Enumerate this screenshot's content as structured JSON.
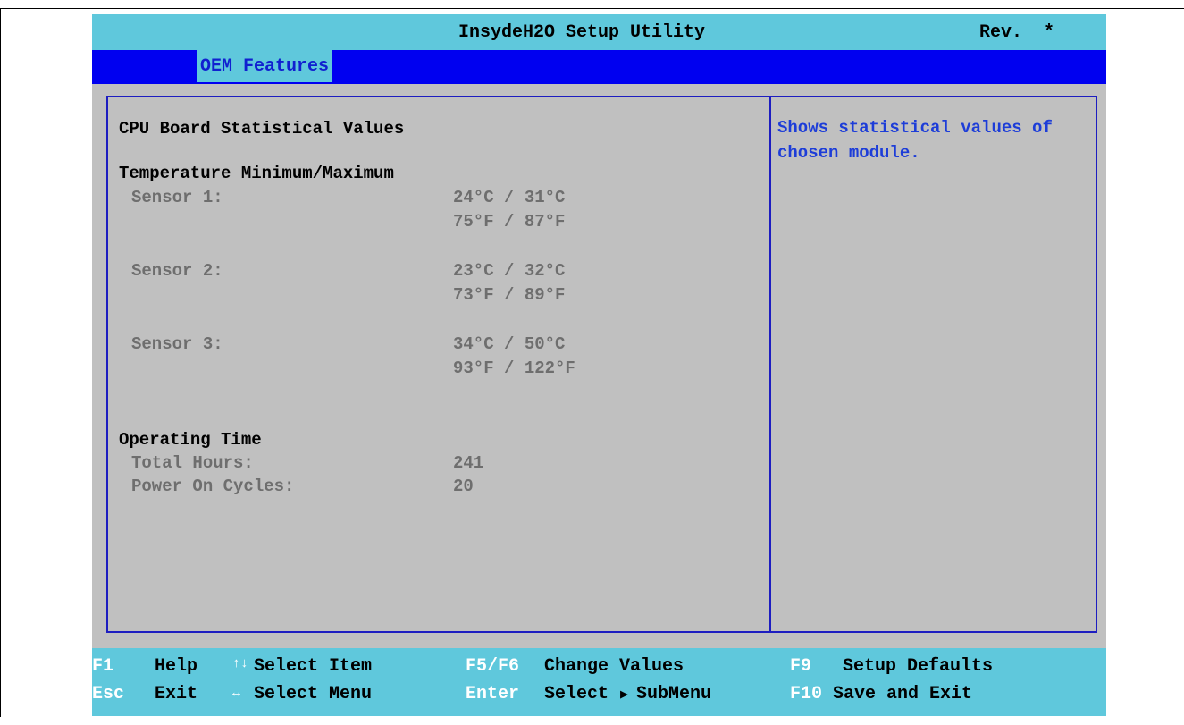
{
  "title": "InsydeH2O Setup Utility",
  "rev": "Rev.  *",
  "menu": {
    "active_tab": "OEM Features"
  },
  "main": {
    "heading": "CPU Board Statistical Values",
    "temp_heading": "Temperature Minimum/Maximum",
    "sensors": [
      {
        "label": "Sensor 1:",
        "celsius": "24°C / 31°C",
        "fahrenheit": "75°F / 87°F"
      },
      {
        "label": "Sensor 2:",
        "celsius": "23°C / 32°C",
        "fahrenheit": "73°F / 89°F"
      },
      {
        "label": "Sensor 3:",
        "celsius": "34°C / 50°C",
        "fahrenheit": "93°F / 122°F"
      }
    ],
    "op_heading": "Operating Time",
    "total_hours_label": "Total Hours:",
    "total_hours_value": "241",
    "power_cycles_label": "Power On Cycles:",
    "power_cycles_value": "20"
  },
  "help": {
    "text": "Shows statistical values of chosen module."
  },
  "footer": {
    "f1_key": "F1",
    "f1_desc": "Help",
    "esc_key": "Esc",
    "esc_desc": "Exit",
    "updown_icon": "↑↓",
    "select_item": "Select Item",
    "leftright_icon": "↔",
    "select_menu": "Select Menu",
    "f5f6_key": "F5/F6",
    "change_values": "Change Values",
    "enter_key": "Enter",
    "select_submenu": "Select",
    "submenu_icon": "▶",
    "submenu_label": "SubMenu",
    "f9_key": "F9",
    "setup_defaults": "Setup Defaults",
    "f10_key": "F10",
    "save_exit": "Save and Exit"
  },
  "colors": {
    "title_bar": "#5fc8dc",
    "menu_bar": "#0000f0",
    "panel_bg": "#c0c0c0",
    "border": "#1d1dc0",
    "help_text": "#1d3dd8",
    "readonly_text": "#6e6e6e"
  }
}
